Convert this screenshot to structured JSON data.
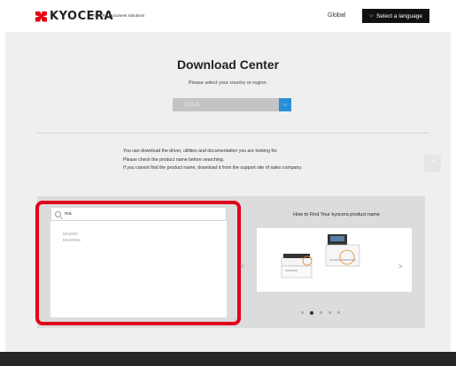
{
  "header": {
    "logo_text": "KYOCERA",
    "logo_sub": "KYOCERA Document Solutions",
    "global_label": "Global",
    "language_button": "Select a language"
  },
  "main": {
    "title": "Download Center",
    "subtitle": "Please select your country or region.",
    "country_value": "U.S.A.",
    "info_lines": [
      "You can download the driver, utilities and documentation you are looking for.",
      "Please check the product name before searching.",
      "If you cannot find the product name, download it from the support site of sales company."
    ]
  },
  "search": {
    "query": "ma",
    "results": [
      "MA2000",
      "MA2000w"
    ]
  },
  "carousel": {
    "title": "How to Find Your kyocera product name",
    "prev": "<",
    "next": ">",
    "slide_count": 5,
    "active_slide": 2
  },
  "colors": {
    "brand_red": "#e60012",
    "accent_blue": "#2a8fd6",
    "highlight_red": "#e0001b"
  }
}
